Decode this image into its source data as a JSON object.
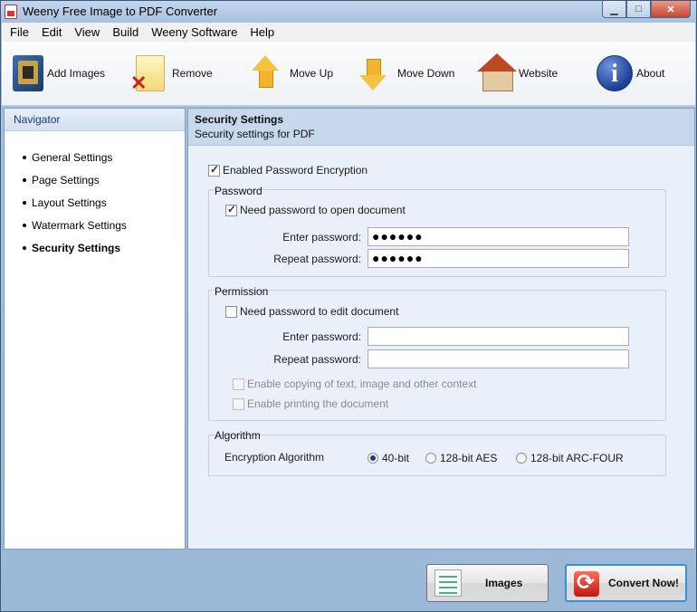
{
  "window": {
    "title": "Weeny Free Image to PDF Converter"
  },
  "menu": [
    "File",
    "Edit",
    "View",
    "Build",
    "Weeny Software",
    "Help"
  ],
  "toolbar": {
    "add_images": "Add Images",
    "remove": "Remove",
    "move_up": "Move Up",
    "move_down": "Move Down",
    "website": "Website",
    "about": "About",
    "about_glyph": "i"
  },
  "navigator": {
    "title": "Navigator",
    "items": [
      {
        "label": "General Settings"
      },
      {
        "label": "Page Settings"
      },
      {
        "label": "Layout Settings"
      },
      {
        "label": "Watermark Settings"
      },
      {
        "label": "Security Settings",
        "active": true
      }
    ]
  },
  "security": {
    "title": "Security Settings",
    "subtitle": "Security settings for PDF",
    "enable_encryption": {
      "label": "Enabled Password Encryption",
      "checked": true
    },
    "password_group": {
      "label": "Password",
      "need_password_open": {
        "label": "Need password to open document",
        "checked": true
      },
      "enter_label": "Enter password:",
      "enter_value": "●●●●●●",
      "repeat_label": "Repeat password:",
      "repeat_value": "●●●●●●"
    },
    "permission_group": {
      "label": "Permission",
      "need_password_edit": {
        "label": "Need password to edit document",
        "checked": false
      },
      "enter_label": "Enter password:",
      "enter_value": "",
      "repeat_label": "Repeat password:",
      "repeat_value": "",
      "enable_copying": {
        "label": "Enable copying of text, image and other context",
        "checked": false,
        "disabled": true
      },
      "enable_printing": {
        "label": "Enable printing the document",
        "checked": false,
        "disabled": true
      }
    },
    "algorithm_group": {
      "label": "Algorithm",
      "field_label": "Encryption Algorithm",
      "options": [
        {
          "label": "40-bit",
          "selected": true
        },
        {
          "label": "128-bit AES",
          "selected": false
        },
        {
          "label": "128-bit ARC-FOUR",
          "selected": false
        }
      ]
    }
  },
  "buttons": {
    "images": "Images",
    "convert": "Convert Now!"
  }
}
